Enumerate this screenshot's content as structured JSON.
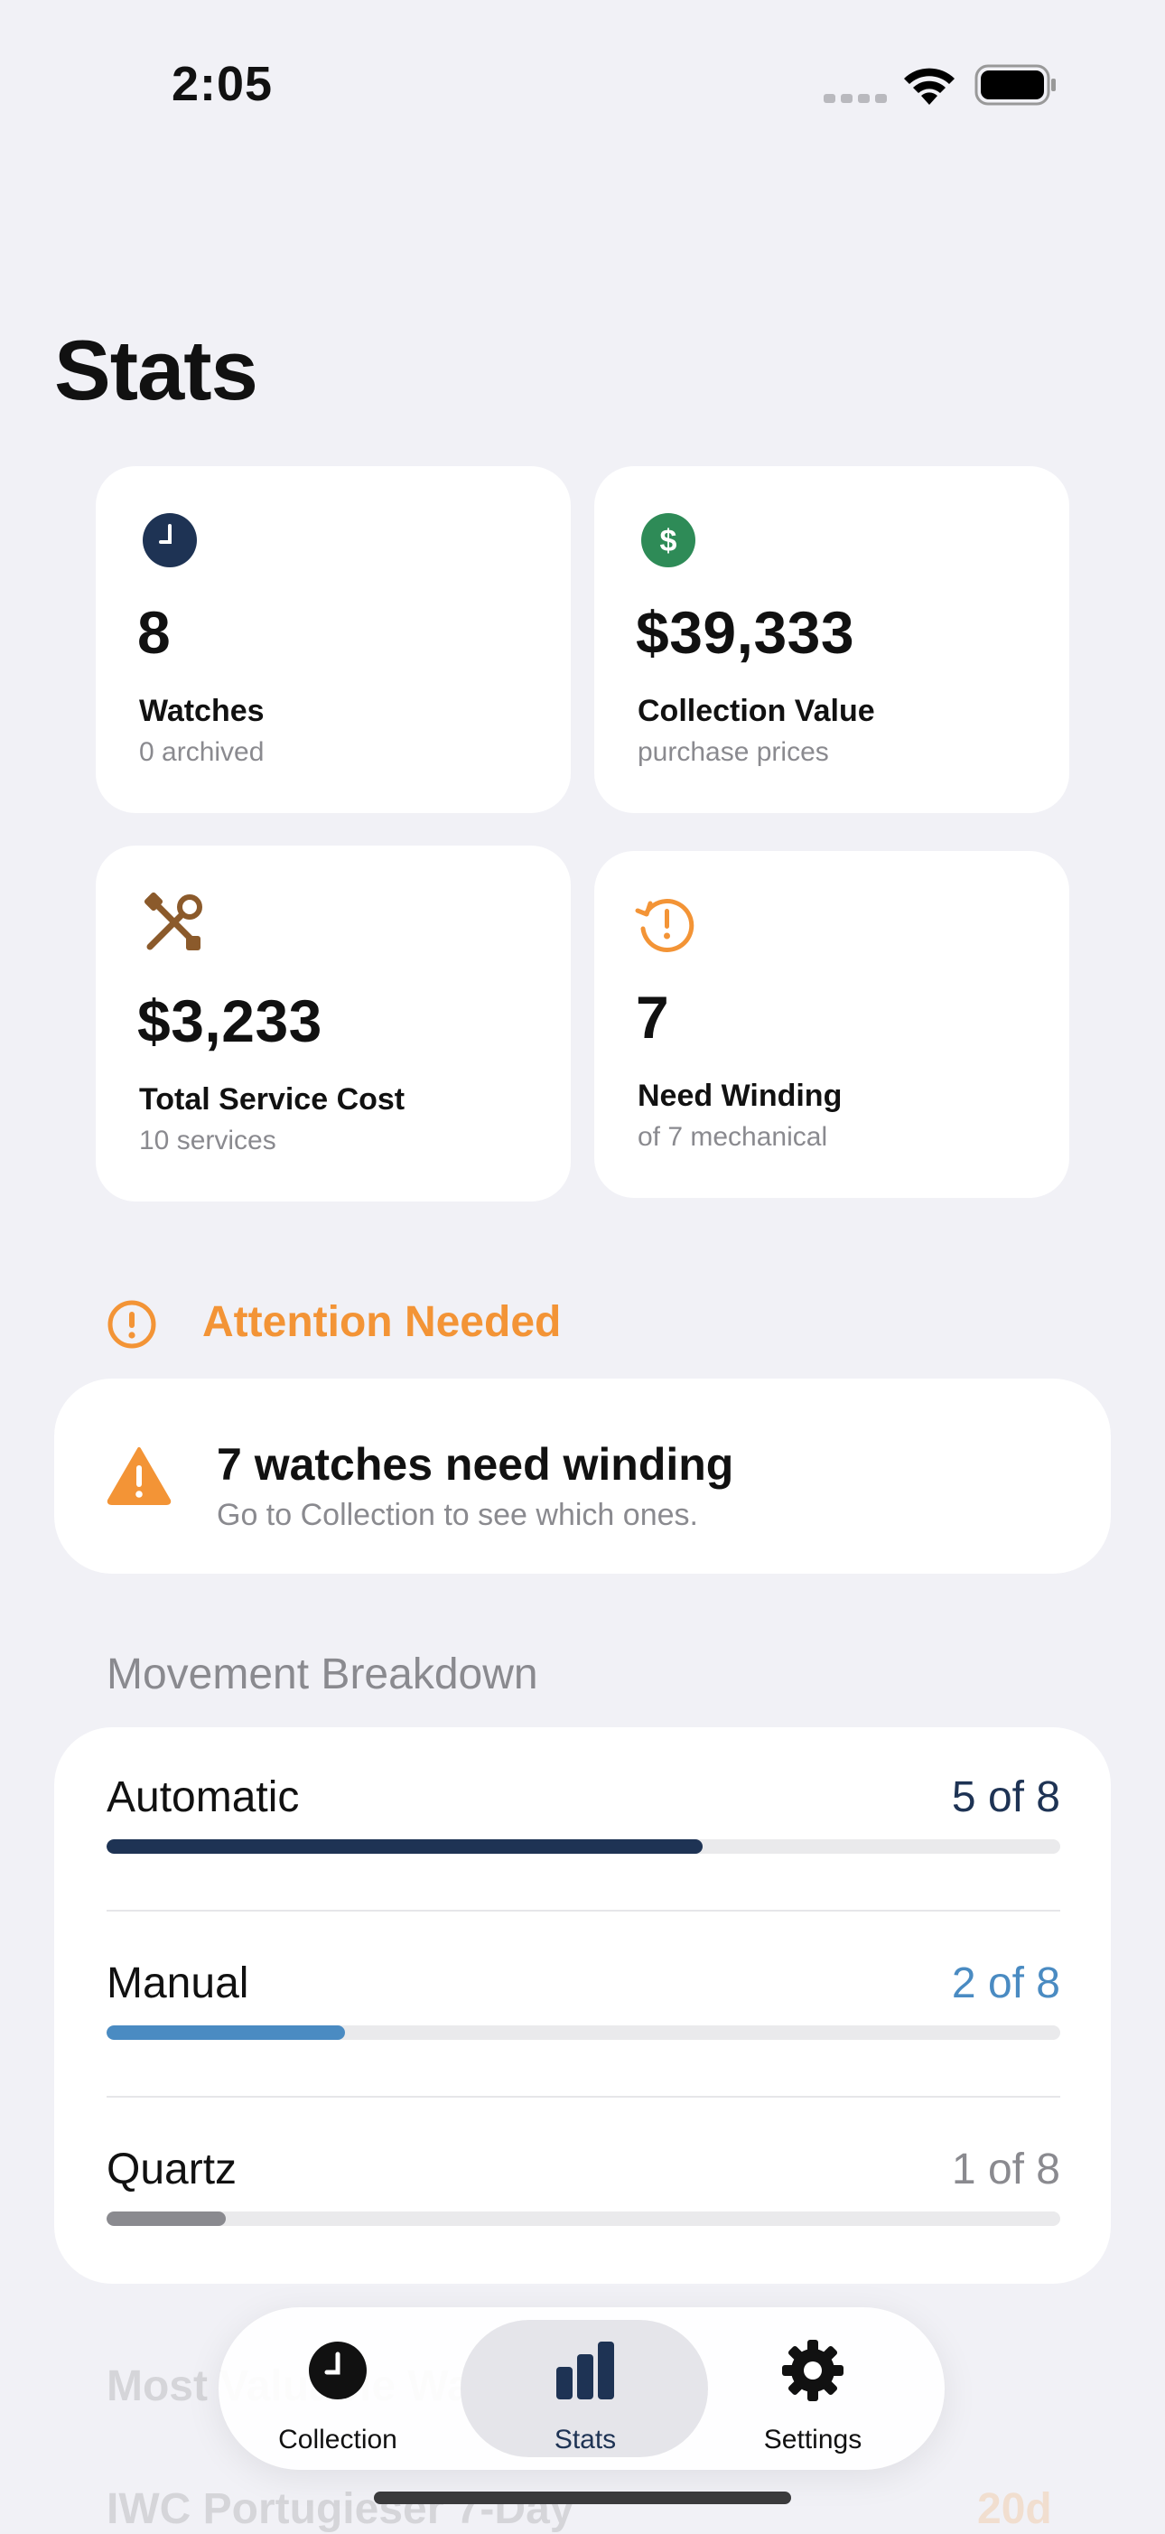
{
  "status_bar": {
    "time": "2:05"
  },
  "title": "Stats",
  "cards": [
    {
      "icon": "clock-icon",
      "value": "8",
      "label": "Watches",
      "sub": "0 archived",
      "color": "#1E3354"
    },
    {
      "icon": "dollar-icon",
      "value": "$39,333",
      "label": "Collection Value",
      "sub": "purchase prices",
      "color": "#2E8B57"
    },
    {
      "icon": "tools-icon",
      "value": "$3,233",
      "label": "Total Service Cost",
      "sub": "10 services",
      "color": "#8B5A2B"
    },
    {
      "icon": "winding-alert-icon",
      "value": "7",
      "label": "Need Winding",
      "sub": "of 7 mechanical",
      "color": "#F39436"
    }
  ],
  "attention": {
    "title": "Attention Needed",
    "alert_title": "7 watches need winding",
    "alert_sub": "Go to Collection to see which ones.",
    "color": "#F39436"
  },
  "movement": {
    "title": "Movement Breakdown",
    "rows": [
      {
        "label": "Automatic",
        "count": "5 of 8",
        "fraction": 0.625,
        "color": "#1E3354"
      },
      {
        "label": "Manual",
        "count": "2 of 8",
        "fraction": 0.25,
        "color": "#4A8BC2"
      },
      {
        "label": "Quartz",
        "count": "1 of 8",
        "fraction": 0.125,
        "color": "#8A8A8F"
      }
    ]
  },
  "faded_content": {
    "section_title": "Most Valuable Watches",
    "item_label": "IWC Portugieser 7-Day",
    "item_value": "20d"
  },
  "tabbar": {
    "tabs": [
      {
        "label": "Collection",
        "icon": "clock-icon",
        "selected": false
      },
      {
        "label": "Stats",
        "icon": "bar-chart-icon",
        "selected": true
      },
      {
        "label": "Settings",
        "icon": "gear-icon",
        "selected": false
      }
    ],
    "selected_color": "#1E3354"
  }
}
